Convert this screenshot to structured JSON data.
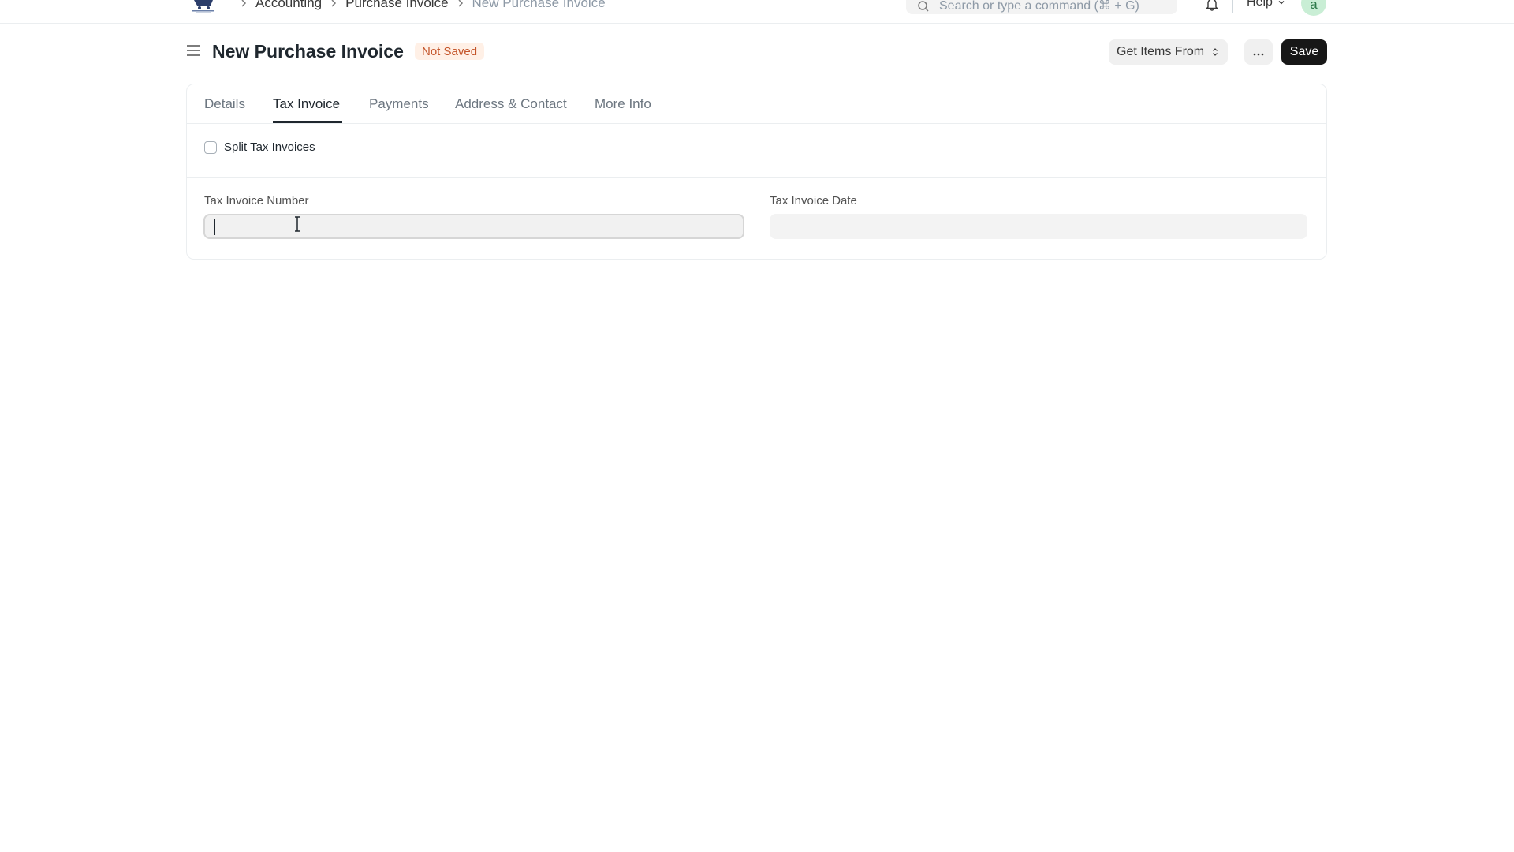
{
  "navbar": {
    "breadcrumbs": [
      "Accounting",
      "Purchase Invoice"
    ],
    "breadcrumb_current": "New Purchase Invoice",
    "search_placeholder": "Search or type a command (⌘ + G)",
    "help_label": "Help",
    "avatar_letter": "a"
  },
  "page": {
    "title": "New Purchase Invoice",
    "status": "Not Saved",
    "get_items_label": "Get Items From",
    "more_label": "···",
    "save_label": "Save"
  },
  "tabs": [
    {
      "label": "Details",
      "active": false
    },
    {
      "label": "Tax Invoice",
      "active": true
    },
    {
      "label": "Payments",
      "active": false
    },
    {
      "label": "Address & Contact",
      "active": false
    },
    {
      "label": "More Info",
      "active": false
    }
  ],
  "form": {
    "split_tax_invoices_label": "Split Tax Invoices",
    "split_tax_invoices_checked": false,
    "tax_invoice_number_label": "Tax Invoice Number",
    "tax_invoice_number_value": "",
    "tax_invoice_date_label": "Tax Invoice Date",
    "tax_invoice_date_value": ""
  },
  "colors": {
    "status_badge_bg": "#fff0e6",
    "status_badge_text": "#c4552a",
    "save_button_bg": "#171717",
    "avatar_bg": "#c9eed5"
  }
}
